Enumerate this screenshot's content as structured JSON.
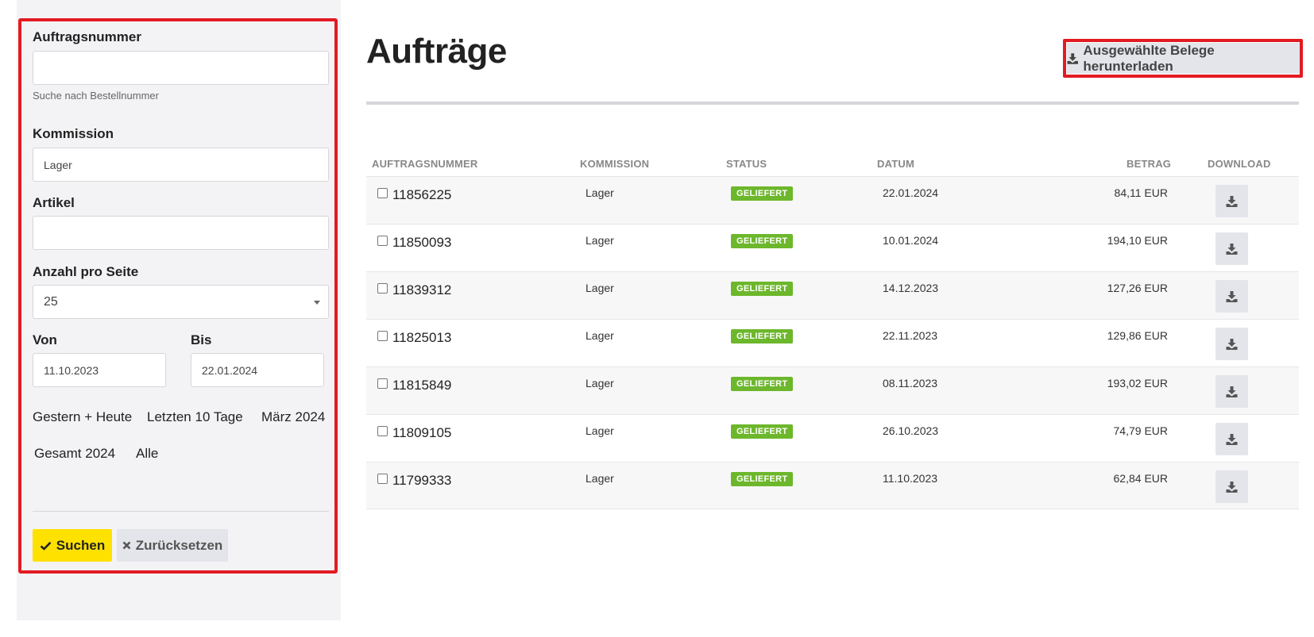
{
  "filters": {
    "order_number_label": "Auftragsnummer",
    "order_number_value": "",
    "order_number_hint": "Suche nach Bestellnummer",
    "commission_label": "Kommission",
    "commission_value": "Lager",
    "article_label": "Artikel",
    "article_value": "",
    "per_page_label": "Anzahl pro Seite",
    "per_page_value": "25",
    "from_label": "Von",
    "from_value": "11.10.2023",
    "to_label": "Bis",
    "to_value": "22.01.2024",
    "quick_ranges": [
      "Gestern + Heute",
      "Letzten 10 Tage",
      "März 2024",
      "Gesamt 2024",
      "Alle"
    ],
    "search_label": "Suchen",
    "reset_label": "Zurücksetzen"
  },
  "header": {
    "title": "Aufträge",
    "download_selected_label": "Ausgewählte Belege herunterladen"
  },
  "table": {
    "columns": [
      "AUFTRAGSNUMMER",
      "KOMMISSION",
      "STATUS",
      "DATUM",
      "BETRAG",
      "DOWNLOAD"
    ],
    "rows": [
      {
        "order": "11856225",
        "commission": "Lager",
        "status": "GELIEFERT",
        "date": "22.01.2024",
        "amount": "84,11 EUR"
      },
      {
        "order": "11850093",
        "commission": "Lager",
        "status": "GELIEFERT",
        "date": "10.01.2024",
        "amount": "194,10 EUR"
      },
      {
        "order": "11839312",
        "commission": "Lager",
        "status": "GELIEFERT",
        "date": "14.12.2023",
        "amount": "127,26 EUR"
      },
      {
        "order": "11825013",
        "commission": "Lager",
        "status": "GELIEFERT",
        "date": "22.11.2023",
        "amount": "129,86 EUR"
      },
      {
        "order": "11815849",
        "commission": "Lager",
        "status": "GELIEFERT",
        "date": "08.11.2023",
        "amount": "193,02 EUR"
      },
      {
        "order": "11809105",
        "commission": "Lager",
        "status": "GELIEFERT",
        "date": "26.10.2023",
        "amount": "74,79 EUR"
      },
      {
        "order": "11799333",
        "commission": "Lager",
        "status": "GELIEFERT",
        "date": "11.10.2023",
        "amount": "62,84 EUR"
      }
    ]
  },
  "colors": {
    "highlight": "#e21b23",
    "search_button": "#ffe100",
    "status_delivered": "#6cb72b",
    "sidebar_bg": "#f3f3f6"
  },
  "icons": [
    "download-icon",
    "check-icon",
    "times-icon",
    "chevron-down-icon"
  ]
}
